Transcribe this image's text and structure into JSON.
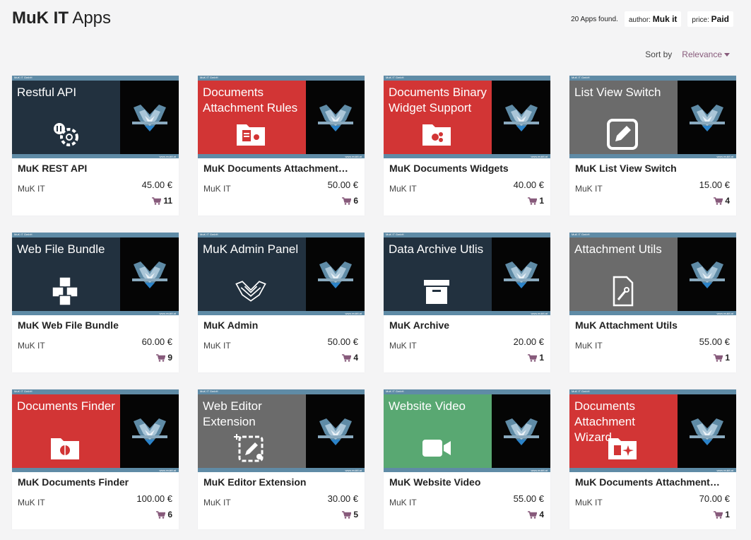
{
  "header": {
    "brand": "MuK IT",
    "section": "Apps"
  },
  "meta": {
    "count": "20 Apps found.",
    "author_label": "author:",
    "author_value": "Muk it",
    "price_label": "price:",
    "price_value": "Paid"
  },
  "sort": {
    "label": "Sort by",
    "value": "Relevance"
  },
  "colors": {
    "navy": "#22313f",
    "red": "#d23535",
    "gray": "#6b6b6b",
    "green": "#59a872",
    "accent": "#875a7b",
    "strip": "#5f8ba6"
  },
  "banner_small_text": {
    "company": "MuK IT GmbH",
    "site": "www.mukit.at"
  },
  "apps": [
    {
      "banner_title": "Restful API",
      "bg": "#22313f",
      "icon": "api-gears-icon",
      "name": "MuK REST API",
      "author": "MuK IT",
      "price": "45.00 €",
      "sales": "11"
    },
    {
      "banner_title": "Documents Attachment Rules",
      "bg": "#d23535",
      "icon": "folder-rules-icon",
      "name": "MuK Documents Attachment…",
      "author": "MuK IT",
      "price": "50.00 €",
      "sales": "6"
    },
    {
      "banner_title": "Documents Binary Widget Support",
      "bg": "#d23535",
      "icon": "folder-gears-icon",
      "name": "MuK Documents Widgets",
      "author": "MuK IT",
      "price": "40.00 €",
      "sales": "1"
    },
    {
      "banner_title": "List View Switch",
      "bg": "#6b6b6b",
      "icon": "pencil-icon",
      "name": "MuK List View Switch",
      "author": "MuK IT",
      "price": "15.00 €",
      "sales": "4"
    },
    {
      "banner_title": "Web File Bundle",
      "bg": "#22313f",
      "icon": "cubes-icon",
      "name": "MuK Web File Bundle",
      "author": "MuK IT",
      "price": "60.00 €",
      "sales": "9"
    },
    {
      "banner_title": "MuK Admin Panel",
      "bg": "#22313f",
      "icon": "muk-logo-outline-icon",
      "name": "MuK Admin",
      "author": "MuK IT",
      "price": "50.00 €",
      "sales": "4"
    },
    {
      "banner_title": "Data Archive Utlis",
      "bg": "#22313f",
      "icon": "archive-box-icon",
      "name": "MuK Archive",
      "author": "MuK IT",
      "price": "20.00 €",
      "sales": "1"
    },
    {
      "banner_title": "Attachment Utils",
      "bg": "#6b6b6b",
      "icon": "file-wrench-icon",
      "name": "MuK Attachment Utils",
      "author": "MuK IT",
      "price": "55.00 €",
      "sales": "1"
    },
    {
      "banner_title": "Documents Finder",
      "bg": "#d23535",
      "icon": "folder-search-icon",
      "name": "MuK Documents Finder",
      "author": "MuK IT",
      "price": "100.00 €",
      "sales": "6"
    },
    {
      "banner_title": "Web Editor Extension",
      "bg": "#6b6b6b",
      "icon": "editor-extension-icon",
      "name": "MuK Editor Extension",
      "author": "MuK IT",
      "price": "30.00 €",
      "sales": "5"
    },
    {
      "banner_title": "Website Video",
      "bg": "#59a872",
      "icon": "video-camera-icon",
      "name": "MuK Website Video",
      "author": "MuK IT",
      "price": "55.00 €",
      "sales": "4"
    },
    {
      "banner_title": "Documents Attachment Wizard",
      "bg": "#d23535",
      "icon": "folder-wizard-icon",
      "name": "MuK Documents Attachment…",
      "author": "MuK IT",
      "price": "70.00 €",
      "sales": "1"
    }
  ]
}
